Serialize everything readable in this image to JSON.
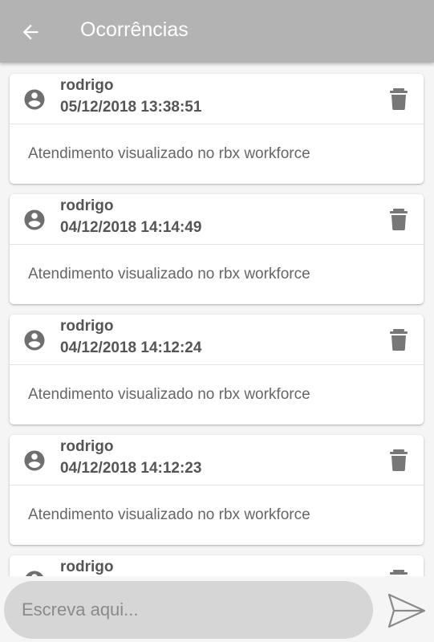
{
  "header": {
    "title": "Ocorrências",
    "back_icon": "arrow-left-icon"
  },
  "colors": {
    "appbar": "#b3b3b3",
    "icon": "#777777",
    "text": "#555555"
  },
  "occurrences": [
    {
      "user": "rodrigo",
      "date": "05/12/2018 13:38:51",
      "message": "Atendimento visualizado no rbx workforce"
    },
    {
      "user": "rodrigo",
      "date": "04/12/2018 14:14:49",
      "message": "Atendimento visualizado no rbx workforce"
    },
    {
      "user": "rodrigo",
      "date": "04/12/2018 14:12:24",
      "message": "Atendimento visualizado no rbx workforce"
    },
    {
      "user": "rodrigo",
      "date": "04/12/2018 14:12:23",
      "message": "Atendimento visualizado no rbx workforce"
    },
    {
      "user": "rodrigo",
      "date": "",
      "message": ""
    }
  ],
  "composer": {
    "placeholder": "Escreva aqui...",
    "send_icon": "send-icon"
  }
}
